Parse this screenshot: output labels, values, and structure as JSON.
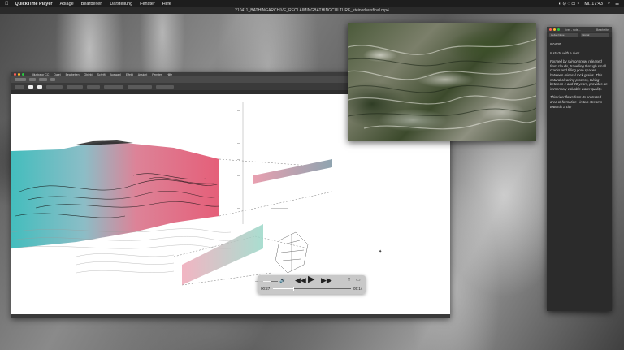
{
  "menubar": {
    "app_name": "QuickTime Player",
    "items": [
      "Ablage",
      "Bearbeiten",
      "Darstellung",
      "Fenster",
      "Hilfe"
    ],
    "clock": "Mi. 17:43"
  },
  "player": {
    "filename": "210411_BATHINGARCHIVE_RECLAIMINGBATHINGCULTURE_steinerhafsfinal.mp4",
    "elapsed": "00:27",
    "remaining": "05:14",
    "progress": 0.26,
    "volume": 0.5
  },
  "illustrator": {
    "app_name": "Illustrator CC",
    "menu_items": [
      "Datei",
      "Bearbeiten",
      "Objekt",
      "Schrift",
      "Auswahl",
      "Effekt",
      "Ansicht",
      "Fenster",
      "Hilfe"
    ]
  },
  "notes": {
    "title": "river - note...",
    "badge": "Bearbeitet",
    "tabs": [
      "Helvet Neue",
      "Nornal"
    ],
    "heading": "RIVER",
    "paragraphs": [
      "It starts with a river.",
      "Formed by rain or snow, released from clouds, travelling through small cracks and filling pore spaces between mineral rock grains. This natural cleaning process, taking between 1 and 20 years, provides an immensely valuable water quality.",
      "This river flows from its protected area of formation - in two streams - towards a city"
    ]
  },
  "colors": {
    "teal": "#2fb6b6",
    "pink": "#e24d6a"
  }
}
